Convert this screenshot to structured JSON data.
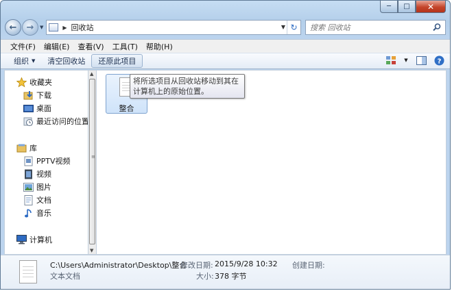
{
  "address": {
    "path": "回收站"
  },
  "search": {
    "placeholder": "搜索 回收站"
  },
  "menu": [
    "文件(F)",
    "编辑(E)",
    "查看(V)",
    "工具(T)",
    "帮助(H)"
  ],
  "toolbar": {
    "organize": "组织",
    "empty": "清空回收站",
    "restore": "还原此项目"
  },
  "nav": {
    "favorites": {
      "label": "收藏夹",
      "items": [
        "下载",
        "桌面",
        "最近访问的位置"
      ]
    },
    "libraries": {
      "label": "库",
      "items": [
        "PPTV视频",
        "视频",
        "图片",
        "文档",
        "音乐"
      ]
    },
    "computer": "计算机"
  },
  "file": {
    "name": "整合"
  },
  "tooltip": "将所选项目从回收站移动到其在计算机上的原始位置。",
  "details": {
    "path": "C:\\Users\\Administrator\\Desktop\\整合",
    "type": "文本文档",
    "modified_label": "修改日期:",
    "modified_value": "2015/9/28 10:32",
    "size_label": "大小:",
    "size_value": "378 字节",
    "created_label": "创建日期:"
  }
}
